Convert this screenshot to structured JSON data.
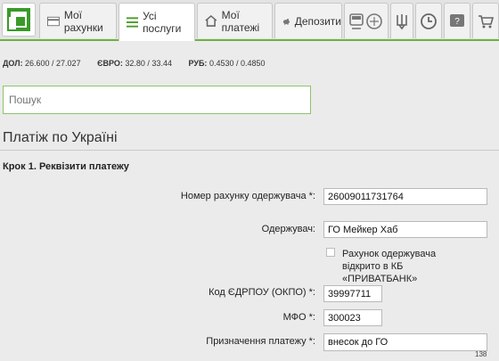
{
  "tabs": [
    {
      "label": "Мої рахунки"
    },
    {
      "label": "Усі послуги"
    },
    {
      "label": "Мої платежі"
    },
    {
      "label": "Депозити"
    }
  ],
  "rates": {
    "usd_label": "ДОЛ:",
    "usd_value": "26.600 / 27.027",
    "eur_label": "ЄВРО:",
    "eur_value": "32.80 / 33.44",
    "rub_label": "РУБ:",
    "rub_value": "0.4530 / 0.4850"
  },
  "search": {
    "placeholder": "Пошук"
  },
  "page": {
    "title": "Платіж по Україні",
    "step": "Крок 1. Реквізити платежу"
  },
  "form": {
    "account_label": "Номер рахунку одержувача *:",
    "account_value": "26009011731764",
    "recipient_label": "Одержувач:",
    "recipient_value": "ГО Мейкер Хаб",
    "privat_checkbox_label": "Рахунок одержувача відкрито в КБ «ПРИВАТБАНК»",
    "edrpou_label": "Код ЄДРПОУ (ОКПО) *:",
    "edrpou_value": "39997711",
    "mfo_label": "МФО *:",
    "mfo_value": "300023",
    "purpose_label": "Призначення платежу *:",
    "purpose_value": "внесок до ГО",
    "purpose_counter": "138"
  },
  "colors": {
    "accent": "#6cb33f",
    "logo_green": "#3a9a2a"
  }
}
